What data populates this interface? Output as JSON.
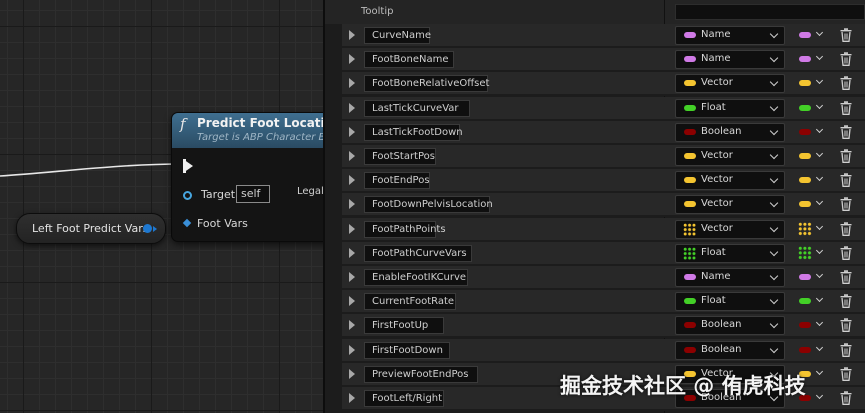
{
  "graph": {
    "function_node": {
      "icon": "function-icon",
      "icon_glyph": "f",
      "title": "Predict Foot Location",
      "subtitle": "Target is ABP Character B",
      "target_label": "Target",
      "target_value": "self",
      "output_label": "Legal",
      "foot_vars_label": "Foot Vars"
    },
    "variable_node": {
      "label": "Left Foot Predict Vars"
    },
    "colors": {
      "node_header": "#3f6f90",
      "struct_pin": "#1e78d0",
      "exec_pin": "#f0f0f0"
    }
  },
  "details": {
    "tooltip_label": "Tooltip",
    "tooltip_value": "",
    "variables": [
      {
        "name": "CurveName",
        "type": "Name",
        "color": "#d07ae6",
        "container": "single"
      },
      {
        "name": "FootBoneName",
        "type": "Name",
        "color": "#d07ae6",
        "container": "single"
      },
      {
        "name": "FootBoneRelativeOffset",
        "type": "Vector",
        "color": "#f4c430",
        "container": "single"
      },
      {
        "name": "LastTickCurveVar",
        "type": "Float",
        "color": "#43d027",
        "container": "single"
      },
      {
        "name": "LastTickFootDown",
        "type": "Boolean",
        "color": "#8c0000",
        "container": "single"
      },
      {
        "name": "FootStartPos",
        "type": "Vector",
        "color": "#f4c430",
        "container": "single"
      },
      {
        "name": "FootEndPos",
        "type": "Vector",
        "color": "#f4c430",
        "container": "single"
      },
      {
        "name": "FootDownPelvisLocation",
        "type": "Vector",
        "color": "#f4c430",
        "container": "single"
      },
      {
        "name": "FootPathPoints",
        "type": "Vector",
        "color": "#f4c430",
        "container": "array"
      },
      {
        "name": "FootPathCurveVars",
        "type": "Float",
        "color": "#43d027",
        "container": "array"
      },
      {
        "name": "EnableFootIKCurve",
        "type": "Name",
        "color": "#d07ae6",
        "container": "single"
      },
      {
        "name": "CurrentFootRate",
        "type": "Float",
        "color": "#43d027",
        "container": "single"
      },
      {
        "name": "FirstFootUp",
        "type": "Boolean",
        "color": "#8c0000",
        "container": "single"
      },
      {
        "name": "FirstFootDown",
        "type": "Boolean",
        "color": "#8c0000",
        "container": "single"
      },
      {
        "name": "PreviewFootEndPos",
        "type": "Vector",
        "color": "#f4c430",
        "container": "single"
      },
      {
        "name": "FootLeft/Right",
        "type": "Boolean",
        "color": "#8c0000",
        "container": "single"
      }
    ],
    "delete_icon": "trash-icon",
    "expand_icon": "expand-arrow-icon",
    "dropdown_icon": "chevron-down-icon"
  },
  "watermark": "掘金技术社区 @ 侑虎科技"
}
